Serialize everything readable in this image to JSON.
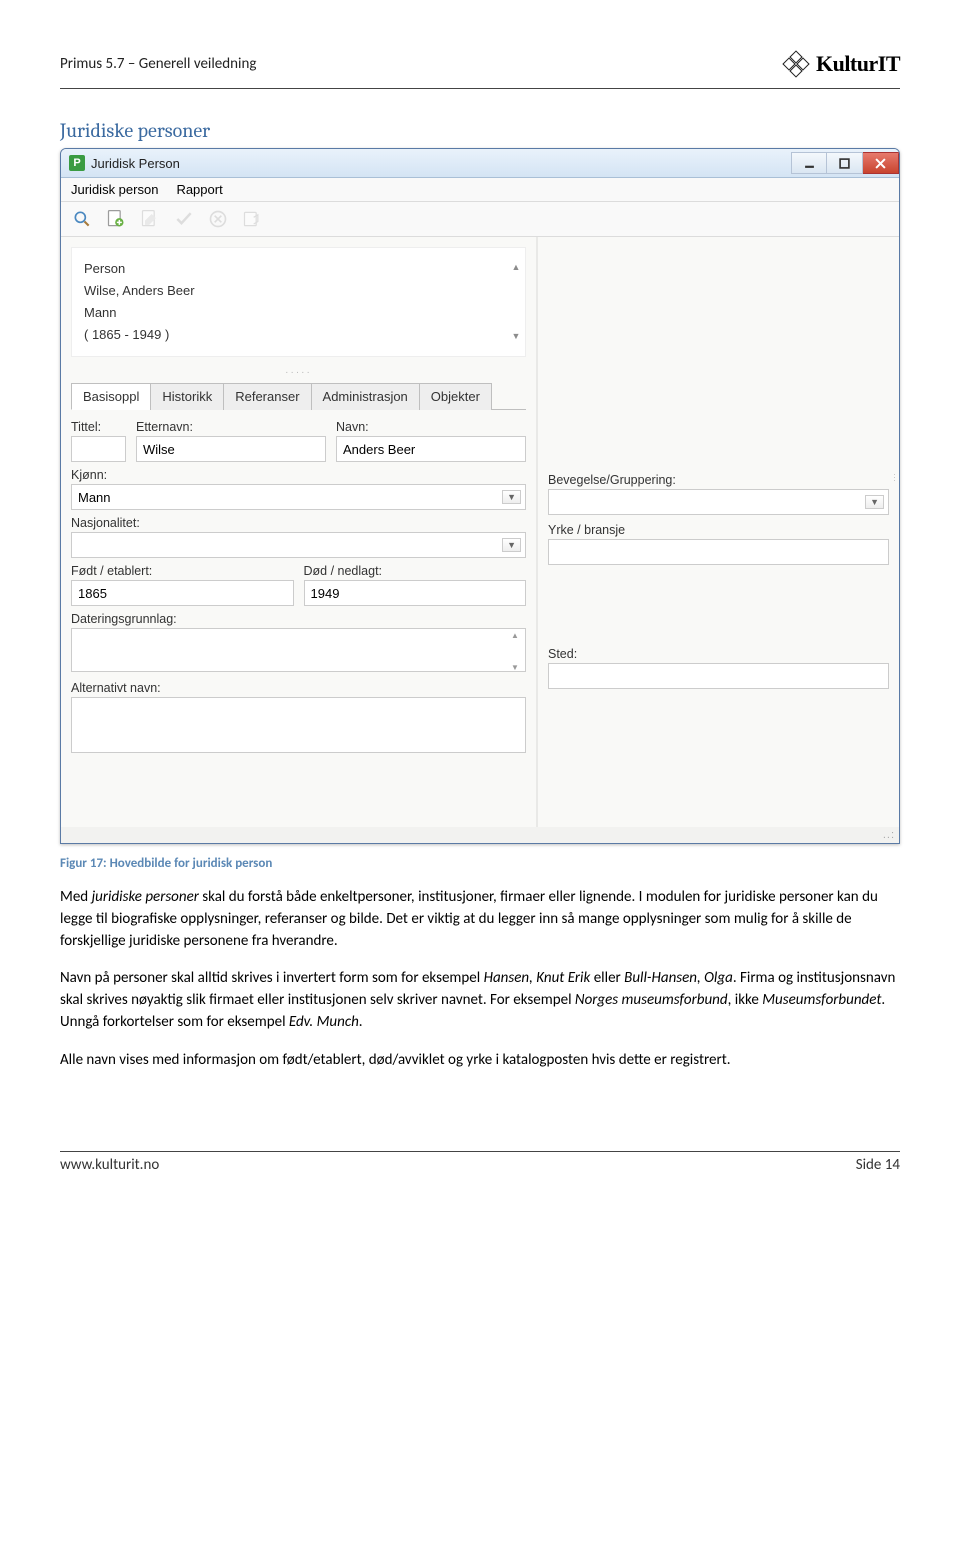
{
  "doc_header": {
    "title": "Primus 5.7 – Generell veiledning",
    "brand": "KulturIT"
  },
  "section_heading": "Juridiske personer",
  "app": {
    "window_title": "Juridisk Person",
    "menus": [
      "Juridisk person",
      "Rapport"
    ],
    "info_panel": {
      "line1": "Person",
      "line2": "Wilse, Anders Beer",
      "line3": "Mann",
      "line4": "( 1865 - 1949 )"
    },
    "tabs": [
      "Basisoppl",
      "Historikk",
      "Referanser",
      "Administrasjon",
      "Objekter"
    ],
    "fields": {
      "tittel_label": "Tittel:",
      "etternavn_label": "Etternavn:",
      "etternavn_value": "Wilse",
      "navn_label": "Navn:",
      "navn_value": "Anders Beer",
      "bevegelse_label": "Bevegelse/Gruppering:",
      "kjonn_label": "Kjønn:",
      "kjonn_value": "Mann",
      "yrke_label": "Yrke / bransje",
      "nasjonalitet_label": "Nasjonalitet:",
      "fodt_label": "Født / etablert:",
      "fodt_value": "1865",
      "dod_label": "Død / nedlagt:",
      "dod_value": "1949",
      "dateringsgrunnlag_label": "Dateringsgrunnlag:",
      "sted_label": "Sted:",
      "altnavn_label": "Alternativt navn:"
    }
  },
  "figure_caption": "Figur 17: Hovedbilde for juridisk person",
  "paragraphs": {
    "p1a": "Med ",
    "p1b": "juridiske personer",
    "p1c": " skal du forstå både enkeltpersoner, institusjoner, firmaer eller lignende. I modulen for juridiske personer kan du legge til biografiske opplysninger, referanser og bilde. Det er viktig at du legger inn så mange opplysninger som mulig for å skille de forskjellige juridiske personene fra hverandre.",
    "p2a": "Navn på personer skal alltid skrives i invertert form som for eksempel ",
    "p2b": "Hansen, Knut Erik",
    "p2c": " eller ",
    "p2d": "Bull-Hansen, Olga",
    "p2e": ". Firma og institusjonsnavn skal skrives nøyaktig slik firmaet eller institusjonen selv skriver navnet. For eksempel ",
    "p2f": "Norges museumsforbund",
    "p2g": ", ikke ",
    "p2h": "Museumsforbundet",
    "p2i": ". Unngå forkortelser som for eksempel ",
    "p2j": "Edv. Munch",
    "p2k": ".",
    "p3": "Alle navn vises med informasjon om født/etablert, død/avviklet og yrke i katalogposten hvis dette er registrert."
  },
  "footer": {
    "left": "www.kulturit.no",
    "right": "Side 14"
  }
}
